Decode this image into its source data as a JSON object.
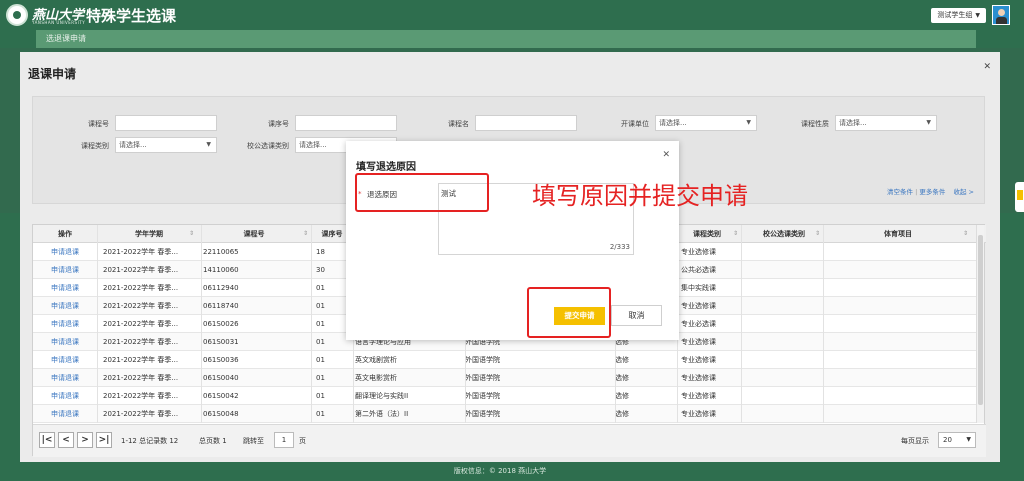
{
  "header": {
    "school_name_cn": "燕山大学",
    "school_name_en": "YANSHAN UNIVERSITY",
    "app_title": "特殊学生选课",
    "user_name": "测试学生组",
    "user_dropdown_icon": "caret-down-icon"
  },
  "subnav": {
    "current": "选退课申请"
  },
  "panel": {
    "title": "退课申请",
    "close_icon": "close-icon",
    "filters": {
      "course_no_label": "课程号",
      "course_no_value": "",
      "course_seq_label": "课序号",
      "course_seq_value": "",
      "course_name_label": "课程名",
      "course_name_value": "",
      "dept_label": "开课单位",
      "dept_value": "请选择...",
      "nature_label": "课程性质",
      "nature_value": "请选择...",
      "category_label": "课程类别",
      "category_value": "请选择...",
      "public_category_label": "校公选课类别",
      "public_category_value": "请选择..."
    },
    "filter_links": {
      "clear": "清空条件",
      "separator": "|",
      "more": "更多条件",
      "collapse": "收起 >"
    }
  },
  "table": {
    "columns": [
      "操作",
      "学年学期",
      "课程号",
      "课序号",
      "",
      "",
      "",
      "课程类别",
      "校公选课类别",
      "体育项目"
    ],
    "rows": [
      {
        "action": "申请退课",
        "term": "2021-2022学年 春季...",
        "course_no": "22110065",
        "seq": "18",
        "name": "",
        "dept": "",
        "nature": "",
        "category": "专业选修课",
        "public_cat": "",
        "sport": ""
      },
      {
        "action": "申请退课",
        "term": "2021-2022学年 春季...",
        "course_no": "14110060",
        "seq": "30",
        "name": "",
        "dept": "",
        "nature": "",
        "category": "公共必选课",
        "public_cat": "",
        "sport": ""
      },
      {
        "action": "申请退课",
        "term": "2021-2022学年 春季...",
        "course_no": "06112940",
        "seq": "01",
        "name": "",
        "dept": "",
        "nature": "",
        "category": "集中实践课",
        "public_cat": "",
        "sport": ""
      },
      {
        "action": "申请退课",
        "term": "2021-2022学年 春季...",
        "course_no": "06118740",
        "seq": "01",
        "name": "",
        "dept": "",
        "nature": "",
        "category": "专业选修课",
        "public_cat": "",
        "sport": ""
      },
      {
        "action": "申请退课",
        "term": "2021-2022学年 春季...",
        "course_no": "061S0026",
        "seq": "01",
        "name": "",
        "dept": "",
        "nature": "",
        "category": "专业必选课",
        "public_cat": "",
        "sport": ""
      },
      {
        "action": "申请退课",
        "term": "2021-2022学年 春季...",
        "course_no": "061S0031",
        "seq": "01",
        "name": "语言学理论与应用",
        "dept": "外国语学院",
        "nature": "选修",
        "category": "专业选修课",
        "public_cat": "",
        "sport": ""
      },
      {
        "action": "申请退课",
        "term": "2021-2022学年 春季...",
        "course_no": "061S0036",
        "seq": "01",
        "name": "英文戏剧赏析",
        "dept": "外国语学院",
        "nature": "选修",
        "category": "专业选修课",
        "public_cat": "",
        "sport": ""
      },
      {
        "action": "申请退课",
        "term": "2021-2022学年 春季...",
        "course_no": "061S0040",
        "seq": "01",
        "name": "英文电影赏析",
        "dept": "外国语学院",
        "nature": "选修",
        "category": "专业选修课",
        "public_cat": "",
        "sport": ""
      },
      {
        "action": "申请退课",
        "term": "2021-2022学年 春季...",
        "course_no": "061S0042",
        "seq": "01",
        "name": "翻译理论与实践II",
        "dept": "外国语学院",
        "nature": "选修",
        "category": "专业选修课",
        "public_cat": "",
        "sport": ""
      },
      {
        "action": "申请退课",
        "term": "2021-2022学年 春季...",
        "course_no": "061S0048",
        "seq": "01",
        "name": "第二外语（法）II",
        "dept": "外国语学院",
        "nature": "选修",
        "category": "专业选修课",
        "public_cat": "",
        "sport": ""
      }
    ]
  },
  "pager": {
    "first_icon": "first-page-icon",
    "first": "|<",
    "prev": "<",
    "next": ">",
    "last": ">|",
    "range_text": "1-12 总记录数 12",
    "pages_text": "总页数 1",
    "goto_label": "跳转至",
    "goto_value": "1",
    "page_unit": "页",
    "page_size_label": "每页显示",
    "page_size_value": "20"
  },
  "footer": {
    "copyright": "版权信息：© 2018 燕山大学"
  },
  "modal": {
    "title": "填写退选原因",
    "required_mark": "*",
    "reason_label": "退选原因",
    "reason_value": "测试",
    "char_count": "2/333",
    "submit_label": "提交申请",
    "cancel_label": "取消"
  },
  "annotation": {
    "text": "填写原因并提交申请",
    "color": "#e52222"
  },
  "colors": {
    "brand_green": "#2e6e4e",
    "accent_yellow": "#f5c000",
    "link_blue": "#3a76c0"
  }
}
